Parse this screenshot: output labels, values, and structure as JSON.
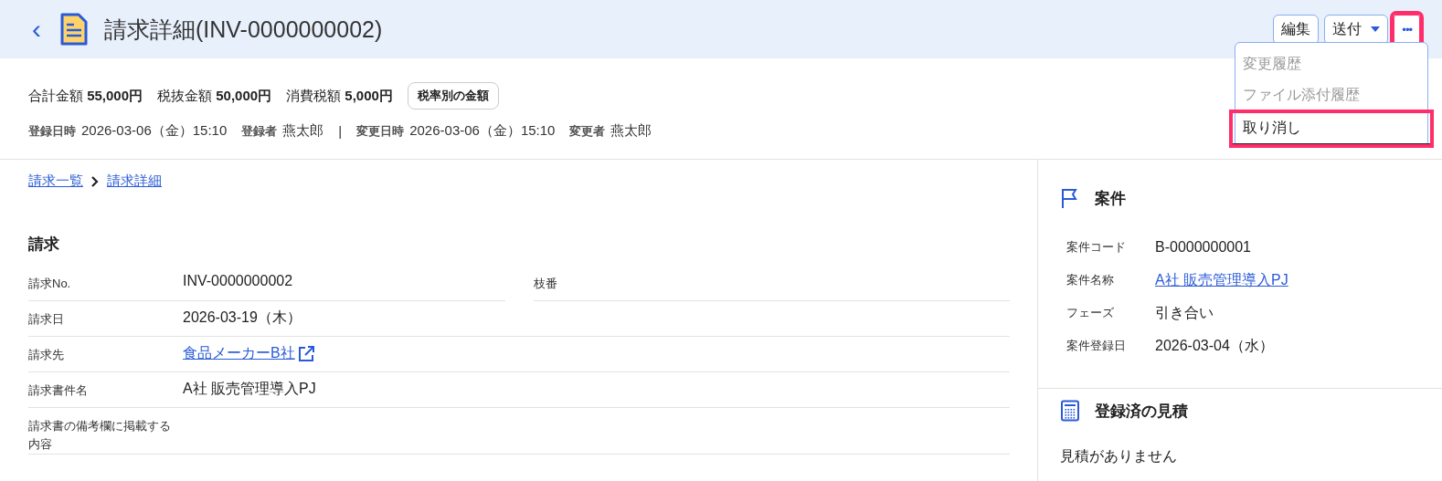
{
  "header": {
    "back": "‹",
    "title": "請求詳細(INV-0000000002)",
    "buttons": [
      {
        "label": "編集",
        "kind": "plain",
        "highlighted": false
      },
      {
        "label": "送付",
        "kind": "dropdown",
        "highlighted": false
      },
      {
        "label": "•••",
        "kind": "more",
        "highlighted": true
      }
    ],
    "menu": [
      {
        "label": "変更履歴",
        "disabled": true,
        "highlighted": false
      },
      {
        "label": "ファイル添付履歴",
        "disabled": true,
        "highlighted": false
      },
      {
        "label": "取り消し",
        "disabled": false,
        "highlighted": true
      }
    ]
  },
  "summary": {
    "amounts": [
      {
        "label": "合計金額",
        "value": "55,000円"
      },
      {
        "label": "税抜金額",
        "value": "50,000円"
      },
      {
        "label": "消費税額",
        "value": "5,000円"
      }
    ],
    "chip": "税率別の金額",
    "meta": [
      {
        "label": "登録日時",
        "value": "2026-03-06（金）15:10"
      },
      {
        "label": "登録者",
        "value": "燕太郎"
      },
      {
        "label": "変更日時",
        "value": "2026-03-06（金）15:10"
      },
      {
        "label": "変更者",
        "value": "燕太郎"
      }
    ],
    "separator": "|"
  },
  "breadcrumb": [
    "請求一覧",
    "請求詳細"
  ],
  "invoice": {
    "heading": "請求",
    "rows": [
      [
        {
          "label": "請求No.",
          "value": "INV-0000000002",
          "kind": "text"
        },
        {
          "label": "枝番"
        }
      ],
      [
        {
          "label": "請求日",
          "value": "2026-03-19（木）",
          "kind": "text"
        }
      ],
      [
        {
          "label": "請求先",
          "value": "食品メーカーB社",
          "kind": "external-link"
        }
      ],
      [
        {
          "label": "請求書件名",
          "value": "A社 販売管理導入PJ",
          "kind": "text"
        }
      ],
      [
        {
          "label": "請求書の備考欄に掲載する内容"
        }
      ]
    ]
  },
  "project": {
    "heading": "案件",
    "fields": [
      {
        "label": "案件コード",
        "value": "B-0000000001",
        "kind": "text"
      },
      {
        "label": "案件名称",
        "value": "A社 販売管理導入PJ",
        "kind": "link"
      },
      {
        "label": "フェーズ",
        "value": "引き合い",
        "kind": "text"
      },
      {
        "label": "案件登録日",
        "value": "2026-03-04（水）",
        "kind": "text"
      }
    ]
  },
  "estimates": {
    "heading": "登録済の見積",
    "empty": "見積がありません"
  }
}
